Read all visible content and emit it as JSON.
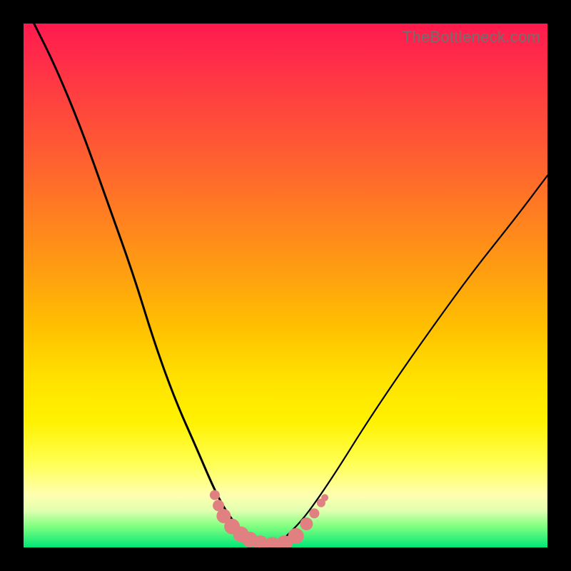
{
  "watermark": "TheBottleneck.com",
  "colors": {
    "black": "#000000",
    "dot": "#e08080",
    "gradient_top": "#ff1a4d",
    "gradient_bottom": "#00e676"
  },
  "chart_data": {
    "type": "line",
    "title": "",
    "xlabel": "",
    "ylabel": "",
    "x_unit_fraction": "0–1 across plot width",
    "y_unit_percent": "bottleneck % (0 at bottom, 100 at top)",
    "xlim": [
      0,
      1
    ],
    "ylim": [
      0,
      100
    ],
    "series": [
      {
        "name": "left-curve",
        "x": [
          0.02,
          0.06,
          0.11,
          0.16,
          0.21,
          0.25,
          0.29,
          0.33,
          0.36,
          0.38,
          0.4,
          0.42,
          0.44,
          0.46,
          0.48
        ],
        "values": [
          100,
          92,
          80,
          66,
          52,
          39,
          28,
          19,
          12,
          8,
          5,
          3,
          2,
          1,
          0
        ]
      },
      {
        "name": "right-curve",
        "x": [
          0.48,
          0.5,
          0.53,
          0.56,
          0.6,
          0.65,
          0.71,
          0.78,
          0.86,
          0.94,
          1.0
        ],
        "values": [
          0,
          2,
          5,
          9,
          15,
          23,
          32,
          42,
          53,
          63,
          71
        ]
      }
    ],
    "dots": [
      {
        "x": 0.365,
        "y": 10,
        "r": 7
      },
      {
        "x": 0.372,
        "y": 8,
        "r": 8
      },
      {
        "x": 0.382,
        "y": 6,
        "r": 10
      },
      {
        "x": 0.398,
        "y": 4,
        "r": 11
      },
      {
        "x": 0.415,
        "y": 2.5,
        "r": 11
      },
      {
        "x": 0.432,
        "y": 1.5,
        "r": 11
      },
      {
        "x": 0.452,
        "y": 0.8,
        "r": 11
      },
      {
        "x": 0.475,
        "y": 0.5,
        "r": 11
      },
      {
        "x": 0.498,
        "y": 0.8,
        "r": 11
      },
      {
        "x": 0.52,
        "y": 2.2,
        "r": 11
      },
      {
        "x": 0.54,
        "y": 4.5,
        "r": 9
      },
      {
        "x": 0.555,
        "y": 6.5,
        "r": 7
      },
      {
        "x": 0.568,
        "y": 8.5,
        "r": 6
      },
      {
        "x": 0.575,
        "y": 9.5,
        "r": 5
      }
    ]
  }
}
